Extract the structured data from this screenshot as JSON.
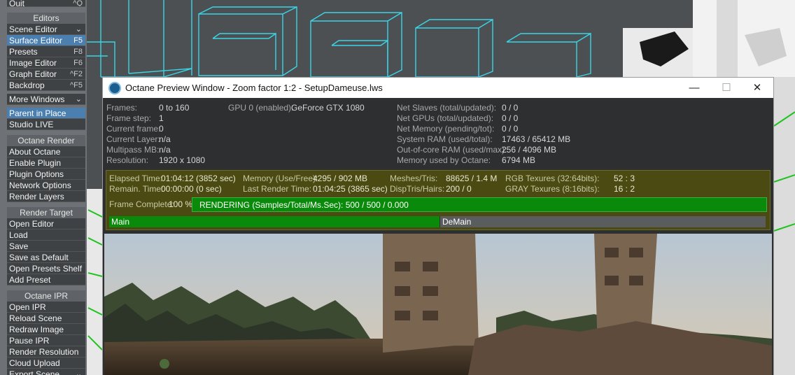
{
  "colors": {
    "wireframe": "#39d5e8",
    "selected": "#4b7fb0",
    "progress_green": "#0a8a0a",
    "stats_bg": "#2d2f31",
    "olive_bg": "#4a4a12"
  },
  "sidebar": {
    "quit": {
      "label": "Quit",
      "key": "^Q"
    },
    "editors": {
      "title": "Editors",
      "items": [
        {
          "label": "Scene Editor",
          "key": "",
          "dropdown": true
        },
        {
          "label": "Surface Editor",
          "key": "F5",
          "selected": true
        },
        {
          "label": "Presets",
          "key": "F8"
        },
        {
          "label": "Image Editor",
          "key": "F6"
        },
        {
          "label": "Graph Editor",
          "key": "^F2"
        },
        {
          "label": "Backdrop",
          "key": "^F5"
        }
      ],
      "more": {
        "label": "More Windows"
      }
    },
    "parent": [
      {
        "label": "Parent in Place",
        "selected": true
      },
      {
        "label": "Studio LIVE"
      }
    ],
    "octane_render": {
      "title": "Octane Render",
      "items": [
        "About Octane",
        "Enable Plugin",
        "Plugin Options",
        "Network Options",
        "Render Layers"
      ]
    },
    "render_target": {
      "title": "Render Target",
      "items": [
        "Open Editor",
        "Load",
        "Save",
        "Save as Default",
        "Open Presets Shelf",
        "Add Preset"
      ]
    },
    "octane_ipr": {
      "title": "Octane IPR",
      "items": [
        "Open IPR",
        "Reload Scene",
        "Redraw Image",
        "Pause IPR",
        "Render Resolution",
        "Cloud Upload"
      ],
      "last": {
        "label": "Export Scene"
      }
    }
  },
  "window": {
    "title": "Octane Preview Window - Zoom factor 1:2 - SetupDameuse.lws",
    "minimize_icon": "minimize-icon",
    "maximize_icon": "maximize-icon",
    "close_icon": "close-icon"
  },
  "stats": {
    "frames_label": "Frames:",
    "frames_value": "0 to 160",
    "framestep_label": "Frame step:",
    "framestep_value": "1",
    "currentframe_label": "Current frame:",
    "currentframe_value": "0",
    "currentlayer_label": "Current Layer:",
    "currentlayer_value": "n/a",
    "multipass_label": "Multipass MB:",
    "multipass_value": "n/a",
    "resolution_label": "Resolution:",
    "resolution_value": "1920 x 1080",
    "gpu_label": "GPU  0 (enabled):",
    "gpu_value": "GeForce GTX 1080",
    "netslaves_label": "Net Slaves (total/updated):",
    "netslaves_value": "0 / 0",
    "netgpus_label": "Net GPUs (total/updated):",
    "netgpus_value": "0 / 0",
    "netmem_label": "Net Memory (pending/tot):",
    "netmem_value": "0 / 0",
    "sysram_label": "System RAM (used/total):",
    "sysram_value": "17463 / 65412 MB",
    "outofcore_label": "Out-of-core RAM (used/max):",
    "outofcore_value": "256 / 4096 MB",
    "memoctane_label": "Memory used by Octane:",
    "memoctane_value": "6794 MB"
  },
  "render_stats": {
    "elapsed_label": "Elapsed Time:",
    "elapsed_value": "01:04:12 (3852 sec)",
    "remain_label": "Remain. Time:",
    "remain_value": "00:00:00 (0 sec)",
    "memory_label": "Memory (Use/Free):",
    "memory_value": "4295 / 902 MB",
    "lastrender_label": "Last Render Time:",
    "lastrender_value": "01:04:25 (3865 sec)",
    "meshes_label": "Meshes/Tris:",
    "meshes_value": "88625 / 1.4 M",
    "disptris_label": "DispTris/Hairs:",
    "disptris_value": "200 / 0",
    "rgb_label": "RGB Texures (32:64bits):",
    "rgb_value": "52 : 3",
    "gray_label": "GRAY Texures (8:16bits):",
    "gray_value": "16 : 2",
    "framecomplete_label": "Frame Complete:",
    "framecomplete_value": "100 %",
    "progress": 1.0,
    "progress_text": "RENDERING (Samples/Total/Ms.Sec): 500 / 500 / 0.000",
    "main_label": "Main",
    "demain_label": "DeMain"
  }
}
